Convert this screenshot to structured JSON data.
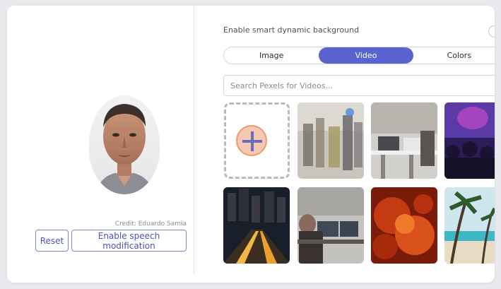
{
  "preview": {
    "credit": "Credit: Eduardo Samia",
    "reset_label": "Reset",
    "speech_label": "Enable speech modification"
  },
  "background": {
    "enable_label": "Enable smart dynamic background",
    "tabs": [
      {
        "label": "Image",
        "selected": false
      },
      {
        "label": "Video",
        "selected": true
      },
      {
        "label": "Colors",
        "selected": false
      }
    ],
    "search_placeholder": "Search Pexels for Videos...",
    "videos": [
      {
        "name": "crowd-walking-blurred"
      },
      {
        "name": "office-workspace"
      },
      {
        "name": "concert-crowd-purple"
      },
      {
        "name": "city-night-traffic"
      },
      {
        "name": "person-at-computer"
      },
      {
        "name": "fire-embers"
      },
      {
        "name": "beach-palm-trees"
      }
    ]
  },
  "colors": {
    "accent": "#5a63cf",
    "button_border": "#7f86c9"
  }
}
